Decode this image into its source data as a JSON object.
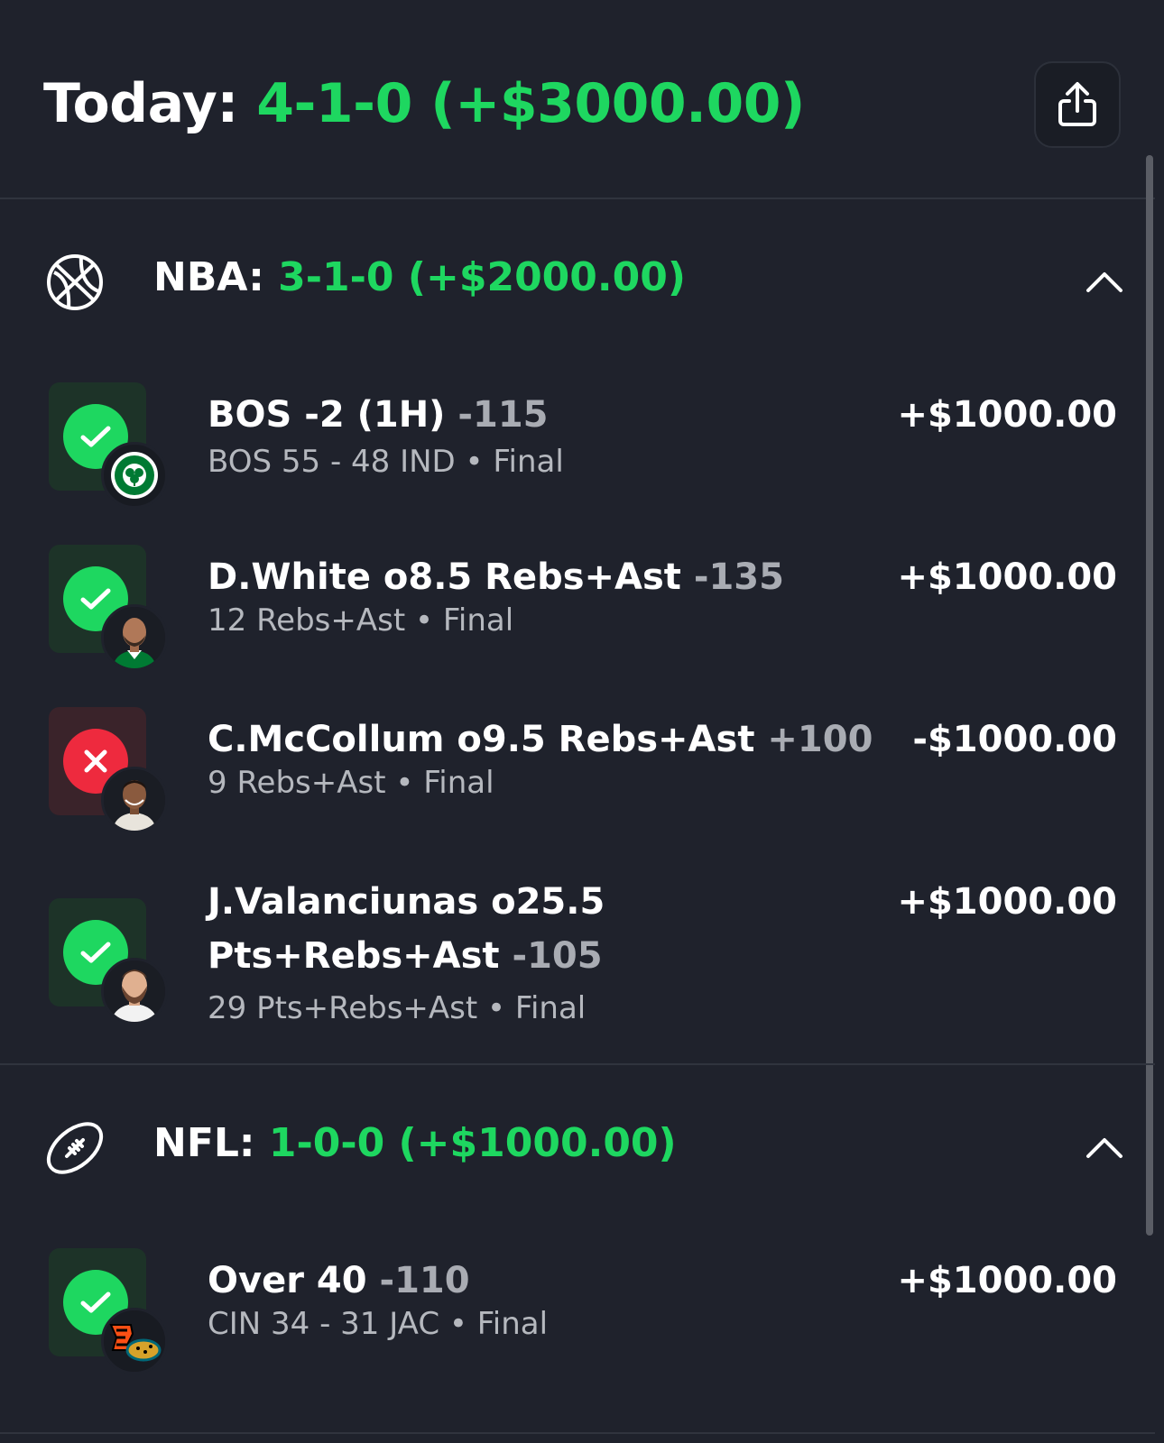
{
  "header": {
    "label": "Today:",
    "record": "4-1-0",
    "profit": "(+$3000.00)",
    "share_icon": "share-icon"
  },
  "sections": [
    {
      "sport": "NBA:",
      "record": "3-1-0",
      "profit": "(+$2000.00)",
      "icon": "basketball-icon",
      "bets": [
        {
          "title": "BOS -2 (1H)",
          "odds": "-115",
          "amount": "+$1000.00",
          "result": "BOS 55 - 48 IND • Final",
          "status": "win",
          "avatar": "celtics-logo"
        },
        {
          "title": "D.White o8.5 Rebs+Ast",
          "odds": "-135",
          "amount": "+$1000.00",
          "result": "12 Rebs+Ast • Final",
          "status": "win",
          "avatar": "player-headshot"
        },
        {
          "title": "C.McCollum o9.5 Rebs+Ast",
          "odds": "+100",
          "amount": "-$1000.00",
          "result": "9 Rebs+Ast • Final",
          "status": "loss",
          "avatar": "player-headshot"
        },
        {
          "title": "J.Valanciunas o25.5 Pts+Rebs+Ast",
          "odds": "-105",
          "amount": "+$1000.00",
          "result": "29 Pts+Rebs+Ast • Final",
          "status": "win",
          "avatar": "player-headshot"
        }
      ]
    },
    {
      "sport": "NFL:",
      "record": "1-0-0",
      "profit": "(+$1000.00)",
      "icon": "football-icon",
      "bets": [
        {
          "title": "Over 40",
          "odds": "-110",
          "amount": "+$1000.00",
          "result": "CIN 34 - 31 JAC • Final",
          "status": "win",
          "avatar": "team-logos"
        }
      ]
    }
  ],
  "colors": {
    "background": "#1f222c",
    "green": "#1ed760",
    "red": "#ee2a3e",
    "muted": "#a9acb3"
  }
}
